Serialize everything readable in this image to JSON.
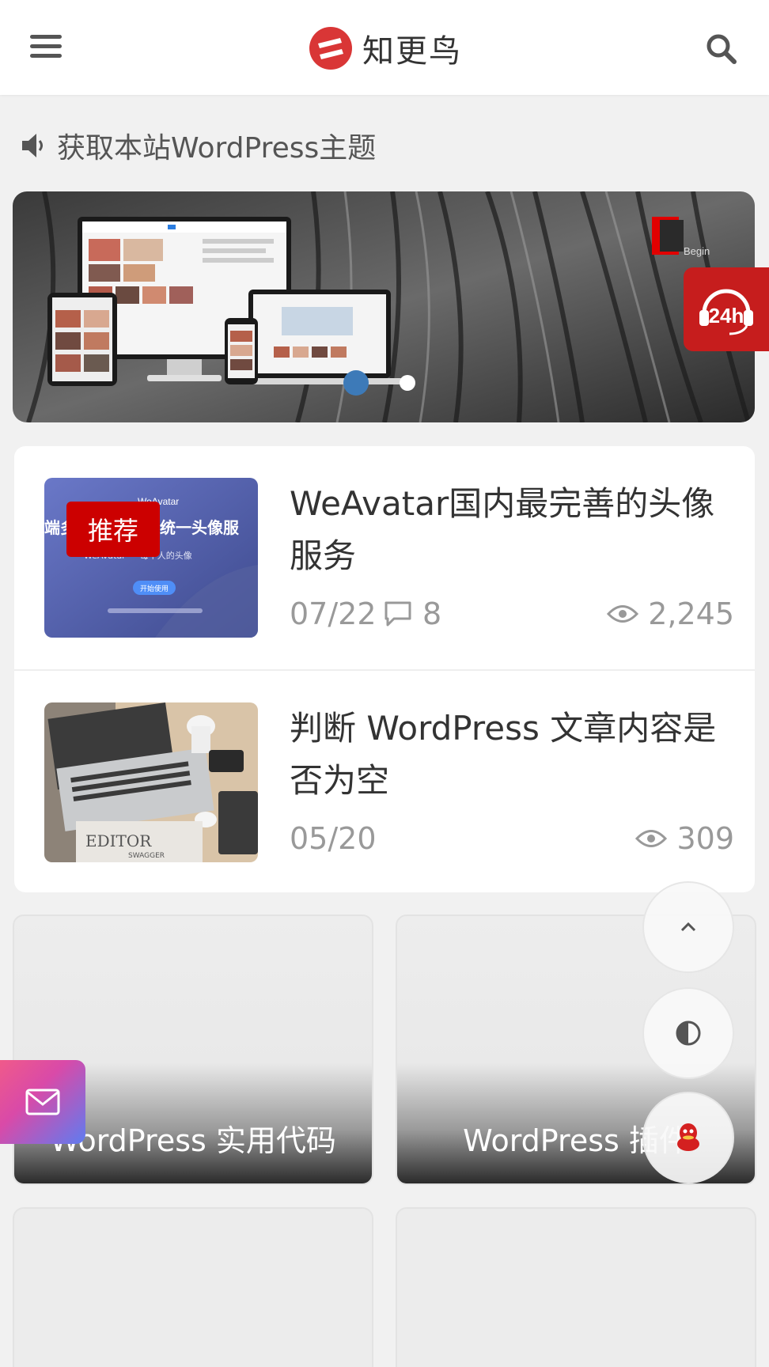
{
  "header": {
    "site_name": "知更鸟",
    "brand_color": "#d93636"
  },
  "notice": {
    "text": "获取本站WordPress主题"
  },
  "slider": {
    "badge_text": "Begin",
    "active_slide": 1,
    "slide_count": 2
  },
  "posts": [
    {
      "tag": "推荐",
      "title": "WeAvatar国内最完善的头像服务",
      "date": "07/22",
      "comments": "8",
      "views": "2,245",
      "thumb": {
        "brand": "WeAvatar",
        "headline": "统一头像服",
        "side": "端多",
        "sub": "WeAvatar — 每个人的头像",
        "button": "开始使用"
      }
    },
    {
      "title": "判断 WordPress 文章内容是否为空",
      "date": "05/20",
      "views": "309",
      "thumb": {
        "book_text": "EDITOR",
        "book_sub": "SWAGGER"
      }
    }
  ],
  "categories": [
    {
      "label": "WordPress 实用代码"
    },
    {
      "label": "WordPress 插件"
    },
    {
      "label": ""
    },
    {
      "label": ""
    }
  ],
  "widgets": {
    "service_label": "24h"
  },
  "colors": {
    "tag_red": "#cc0000",
    "dot_active": "#3d7ab8",
    "service_red": "#c61d1d"
  }
}
